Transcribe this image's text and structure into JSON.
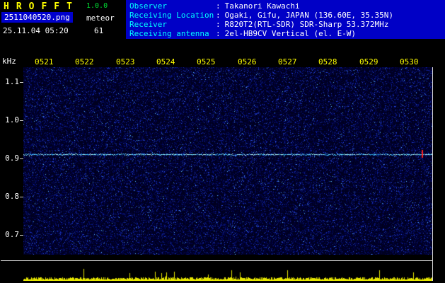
{
  "header": {
    "title": "HROFFT",
    "version": "1.0.0",
    "filename": "2511040520.png",
    "mode": "meteor",
    "datetime": "25.11.04 05:20",
    "count": "61",
    "colon": ":",
    "rows": [
      {
        "label": "Observer",
        "value": "Takanori Kawachi"
      },
      {
        "label": "Receiving Location",
        "value": "Ogaki, Gifu, JAPAN (136.60E, 35.35N)"
      },
      {
        "label": "Receiver",
        "value": "R820T2(RTL-SDR) SDR-Sharp 53.372MHz"
      },
      {
        "label": "Receiving antenna",
        "value": "2el-HB9CV Vertical (el. E-W)"
      }
    ]
  },
  "chart_data": {
    "type": "heatmap",
    "description": "Radio meteor observation spectrogram (HROFFT), dark blue random noise background with one continuous carrier line",
    "x_ticks": [
      "0521",
      "0522",
      "0523",
      "0524",
      "0525",
      "0526",
      "0527",
      "0528",
      "0529",
      "0530"
    ],
    "y_unit": "kHz",
    "y_ticks": [
      "1.1",
      "1.0",
      "0.9",
      "0.8",
      "0.7"
    ],
    "ylim": [
      0.65,
      1.15
    ],
    "series": [
      {
        "name": "carrier-line",
        "frequency_khz": 0.91,
        "extent": "full width, constant frequency"
      },
      {
        "name": "signal-level-strip",
        "description": "yellow noise-level trace along bottom strip"
      }
    ]
  },
  "colors": {
    "header_bg": "#0000c6",
    "filename_bg": "#0000cc",
    "title_yellow": "#ffff00",
    "version_green": "#00dd33",
    "label_cyan": "#00ffff",
    "text_white": "#ffffff",
    "spec_base": "#000020",
    "noise1": "#000043",
    "noise2": "#000a66",
    "noise3": "#1226a8",
    "noise4": "#2a4ae0",
    "noise5": "#58b8ff",
    "carrier1": "#bfffff",
    "carrier2": "#49d4ff",
    "carrier3": "#1a78d8",
    "echo_mark": "#ff2222",
    "strip_line": "#e6e600"
  }
}
